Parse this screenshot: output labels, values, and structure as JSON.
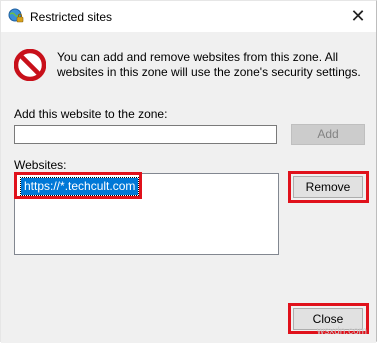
{
  "window": {
    "title": "Restricted sites",
    "close_glyph": "✕"
  },
  "info": {
    "icon": "no-entry-icon",
    "text": "You can add and remove websites from this zone. All websites in this zone will use the zone's security settings."
  },
  "add_section": {
    "label": "Add this website to the zone:",
    "input_value": "",
    "add_button": "Add"
  },
  "websites": {
    "label": "Websites:",
    "items": [
      "https://*.techcult.com"
    ],
    "remove_button": "Remove"
  },
  "close_button": "Close",
  "watermark": "wsxdn.com",
  "colors": {
    "highlight": "#e0111b",
    "selection": "#0078d7"
  }
}
